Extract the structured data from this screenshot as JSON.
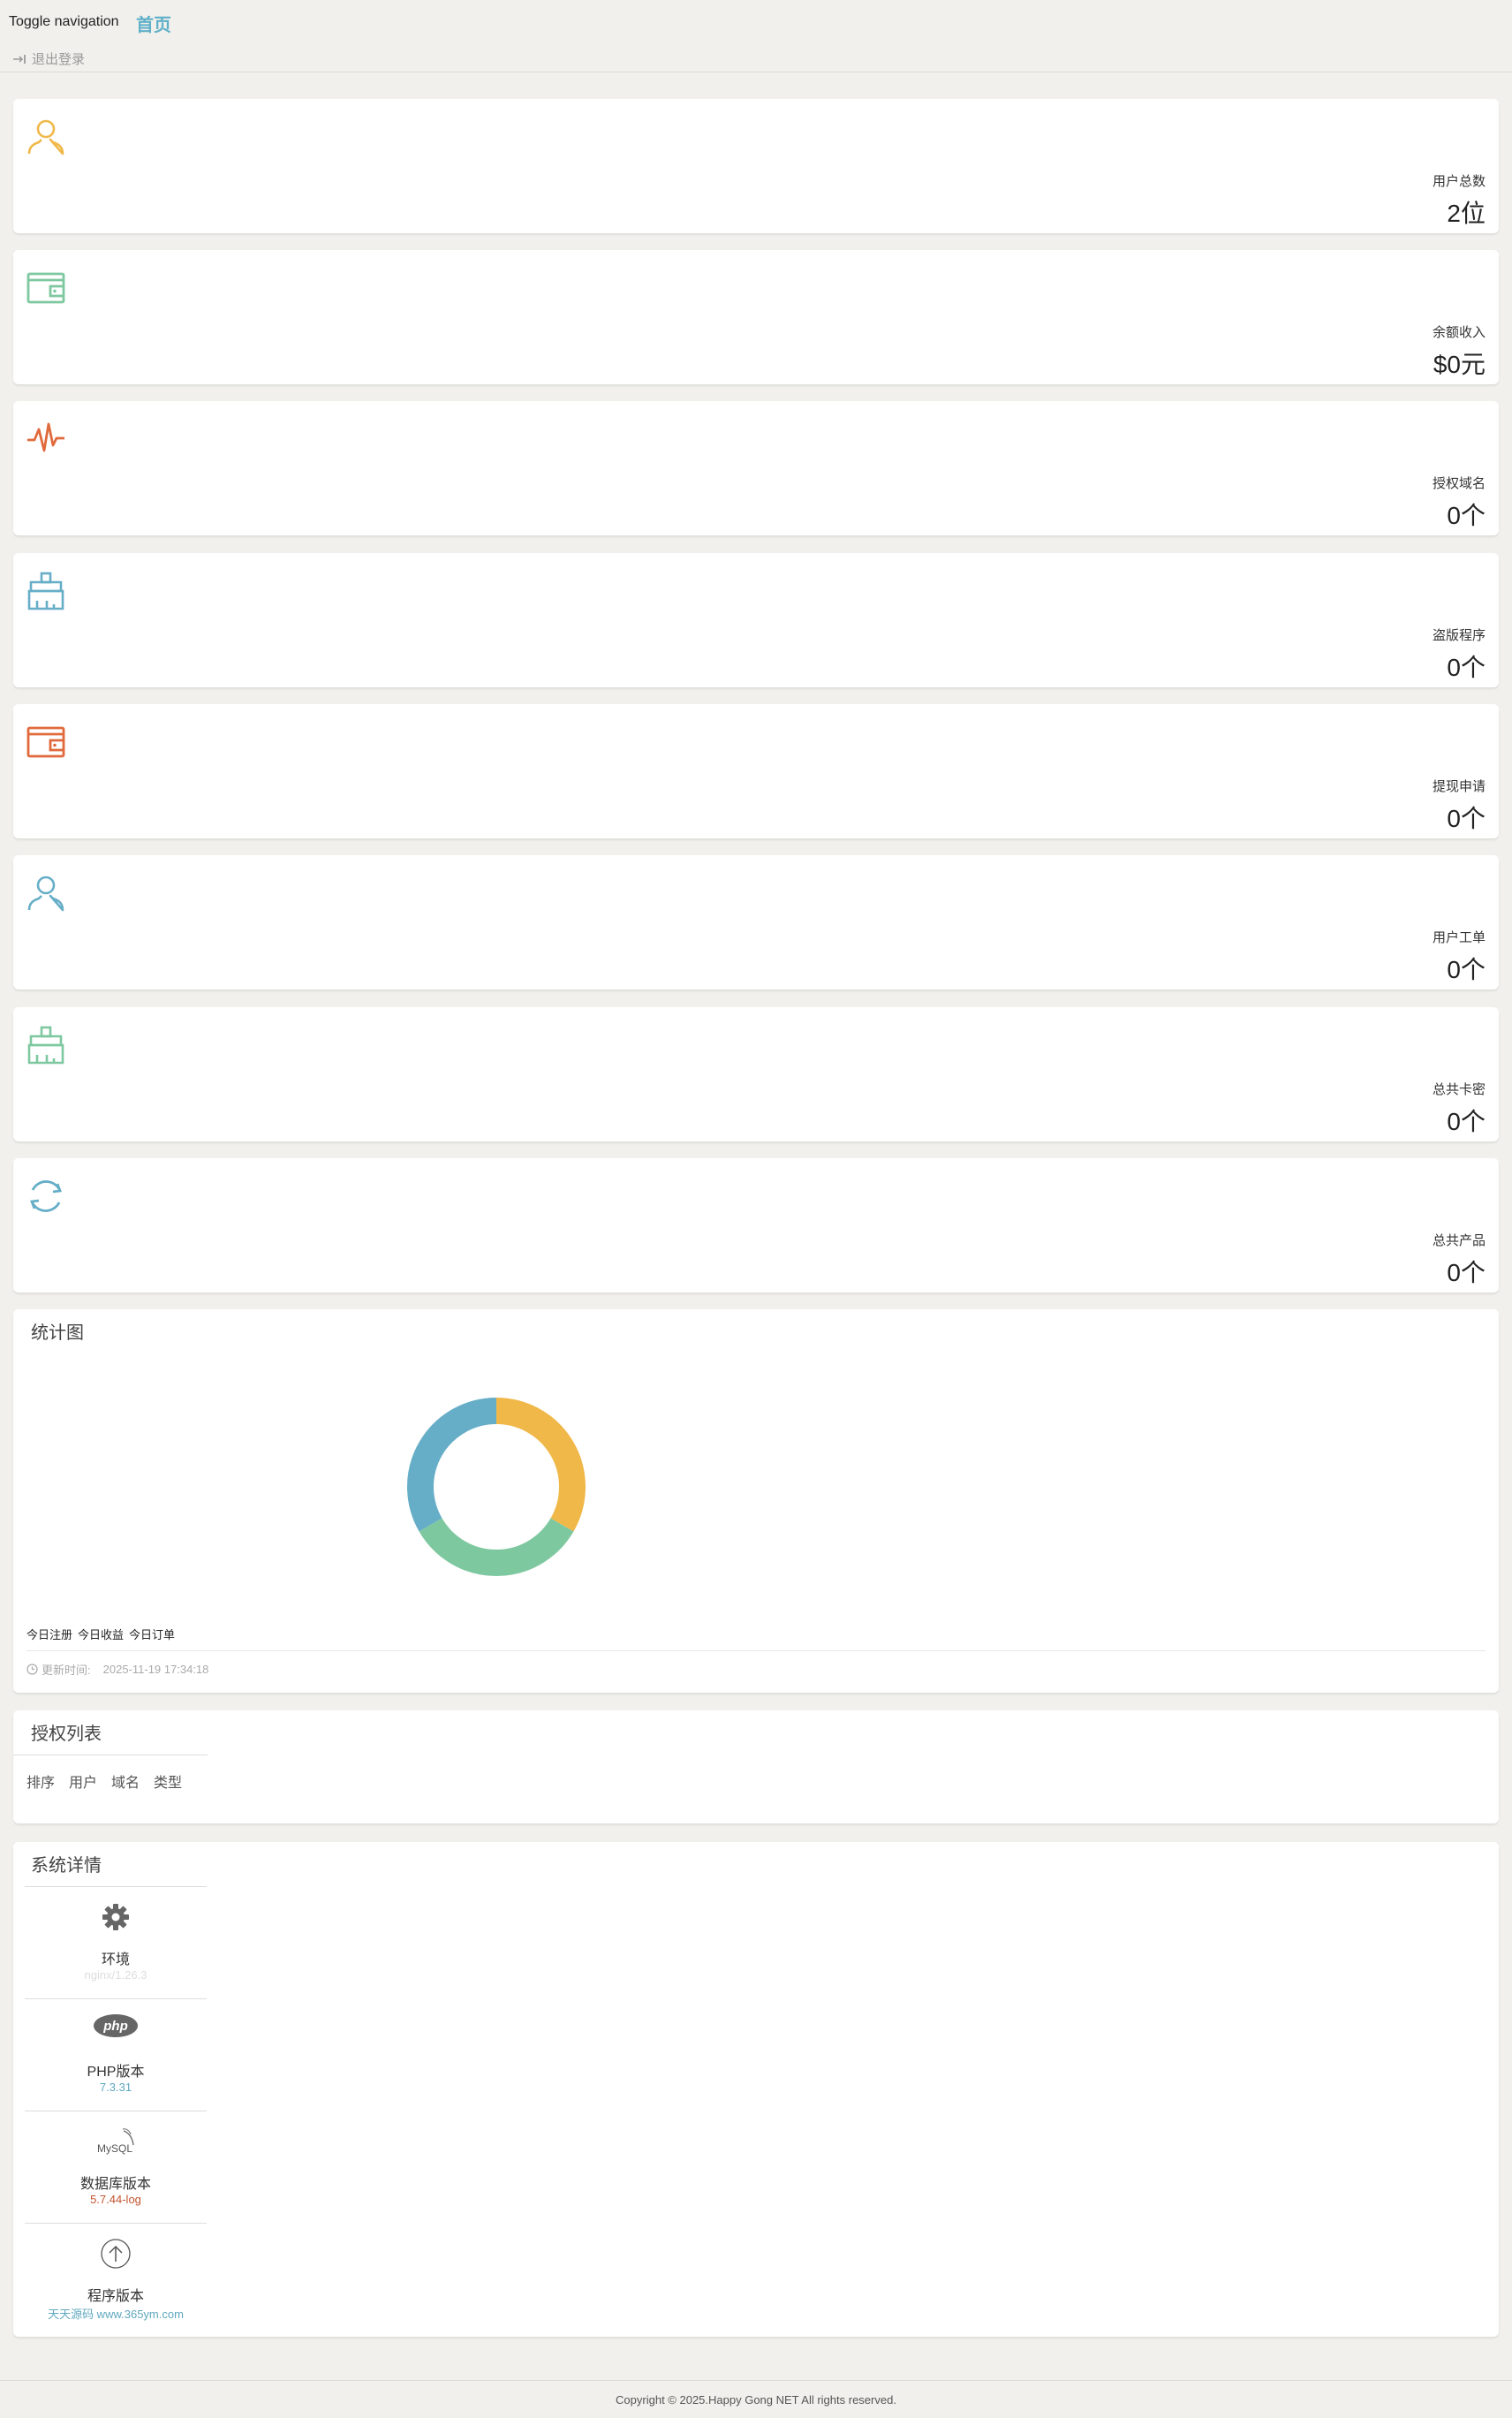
{
  "nav": {
    "toggle": "Toggle navigation",
    "home": "首页",
    "logout": "退出登录"
  },
  "stats": [
    {
      "label": "用户总数",
      "value": "2位",
      "icon": "user-icon",
      "color": "#f0b849"
    },
    {
      "label": "余额收入",
      "value": "$0元",
      "icon": "wallet-icon",
      "color": "#7ec8a0"
    },
    {
      "label": "授权域名",
      "value": "0个",
      "icon": "pulse-icon",
      "color": "#e06a3c"
    },
    {
      "label": "盗版程序",
      "value": "0个",
      "icon": "broom-icon",
      "color": "#66aec7"
    },
    {
      "label": "提现申请",
      "value": "0个",
      "icon": "wallet-icon",
      "color": "#e06a3c"
    },
    {
      "label": "用户工单",
      "value": "0个",
      "icon": "user-icon",
      "color": "#66aec7"
    },
    {
      "label": "总共卡密",
      "value": "0个",
      "icon": "broom-icon",
      "color": "#7ec8a0"
    },
    {
      "label": "总共产品",
      "value": "0个",
      "icon": "refresh-icon",
      "color": "#66aec7"
    }
  ],
  "chart_panel": {
    "title": "统计图",
    "legend": [
      "今日注册",
      "今日收益",
      "今日订单"
    ],
    "update_label": "更新时间:",
    "update_time": "2025-11-19 17:34:18"
  },
  "chart_data": {
    "type": "pie",
    "categories": [
      "今日注册",
      "今日收益",
      "今日订单"
    ],
    "values": [
      1,
      1,
      1
    ],
    "colors": [
      "#f0b849",
      "#7ec8a0",
      "#66aec7"
    ],
    "donut": true
  },
  "auth_panel": {
    "title": "授权列表",
    "columns": [
      "排序",
      "用户",
      "域名",
      "类型"
    ]
  },
  "sys_panel": {
    "title": "系统详情",
    "items": [
      {
        "name": "环境",
        "value": "nginx/1.26.3",
        "icon": "gear-icon",
        "value_color": "#ddd"
      },
      {
        "name": "PHP版本",
        "value": "7.3.31",
        "icon": "php-icon",
        "value_color": "#5fa8bf"
      },
      {
        "name": "数据库版本",
        "value": "5.7.44-log",
        "icon": "mysql-icon",
        "value_color": "#c0552e"
      },
      {
        "name": "程序版本",
        "value": "天天源码 www.365ym.com",
        "icon": "upload-arrow-icon",
        "value_color": "#5fa8bf"
      }
    ]
  },
  "footer": {
    "text": "Copyright © 2025.Happy Gong NET All rights reserved."
  }
}
